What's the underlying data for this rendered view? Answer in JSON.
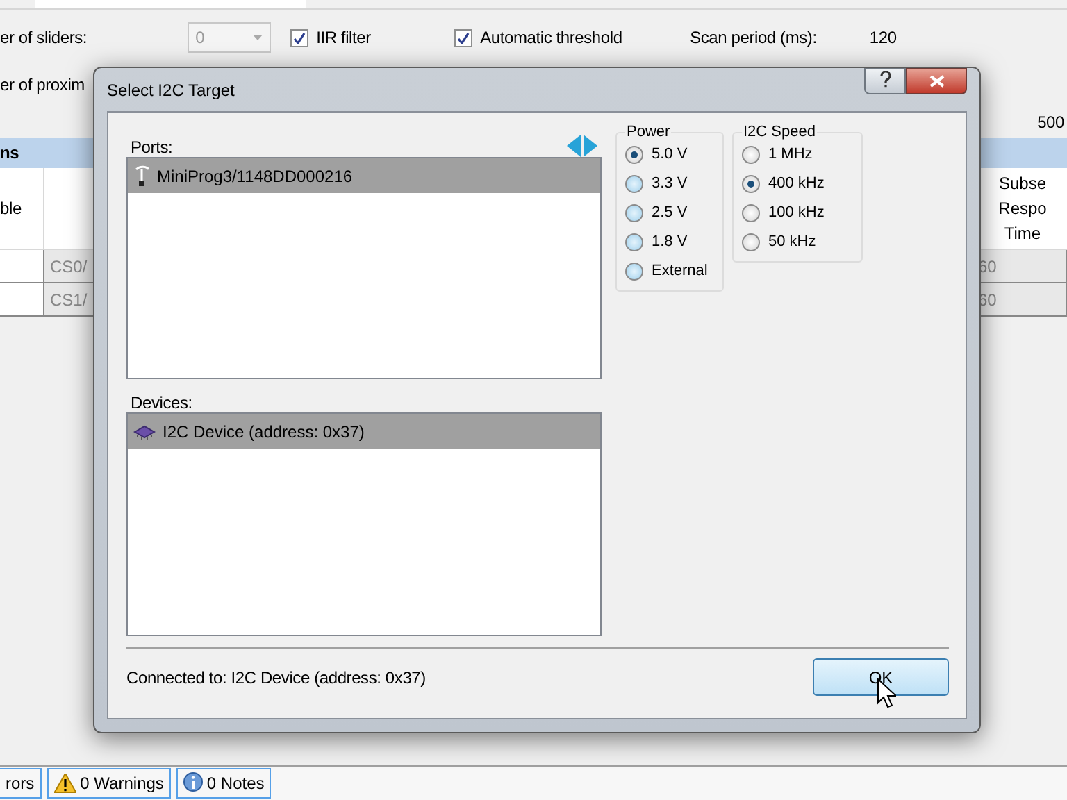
{
  "background": {
    "settings": [
      {
        "label": "er of sliders:",
        "value": "0"
      },
      {
        "label": "er of proxim"
      }
    ],
    "checks": [
      {
        "label": "IIR filter",
        "checked": true
      },
      {
        "label": "Automatic threshold",
        "checked": true
      }
    ],
    "scan_period": {
      "label": "Scan period (ms):",
      "value": "120"
    },
    "slider_value": "500",
    "section_title": "ns",
    "table": {
      "column_1": "ble",
      "column_last": "Subse Respo Time",
      "rows": [
        {
          "column_2": "CS0/",
          "column_last": "60"
        },
        {
          "column_2": "CS1/",
          "column_last": "60"
        }
      ]
    },
    "status_bar": [
      {
        "kind": "plain",
        "label": "rors"
      },
      {
        "kind": "warning",
        "label": "0 Warnings"
      },
      {
        "kind": "info",
        "label": "0 Notes"
      }
    ]
  },
  "dialog": {
    "title": "Select I2C Target",
    "ports": {
      "label": "Ports:",
      "items": [
        {
          "label": "MiniProg3/1148DD000216",
          "selected": true
        }
      ]
    },
    "devices": {
      "label": "Devices:",
      "items": [
        {
          "label": "I2C Device (address: 0x37)",
          "selected": true
        }
      ]
    },
    "power": {
      "label": "Power",
      "options": [
        {
          "label": "5.0 V",
          "selected": true
        },
        {
          "label": "3.3 V",
          "selected": false
        },
        {
          "label": "2.5 V",
          "selected": false
        },
        {
          "label": "1.8 V",
          "selected": false
        },
        {
          "label": "External",
          "selected": false
        }
      ]
    },
    "speed": {
      "label": "I2C Speed",
      "options": [
        {
          "label": "1 MHz",
          "selected": false
        },
        {
          "label": "400 kHz",
          "selected": true
        },
        {
          "label": "100 kHz",
          "selected": false
        },
        {
          "label": "50 kHz",
          "selected": false
        }
      ]
    },
    "status": "Connected to: I2C Device (address: 0x37)",
    "ok_button": "OK"
  }
}
